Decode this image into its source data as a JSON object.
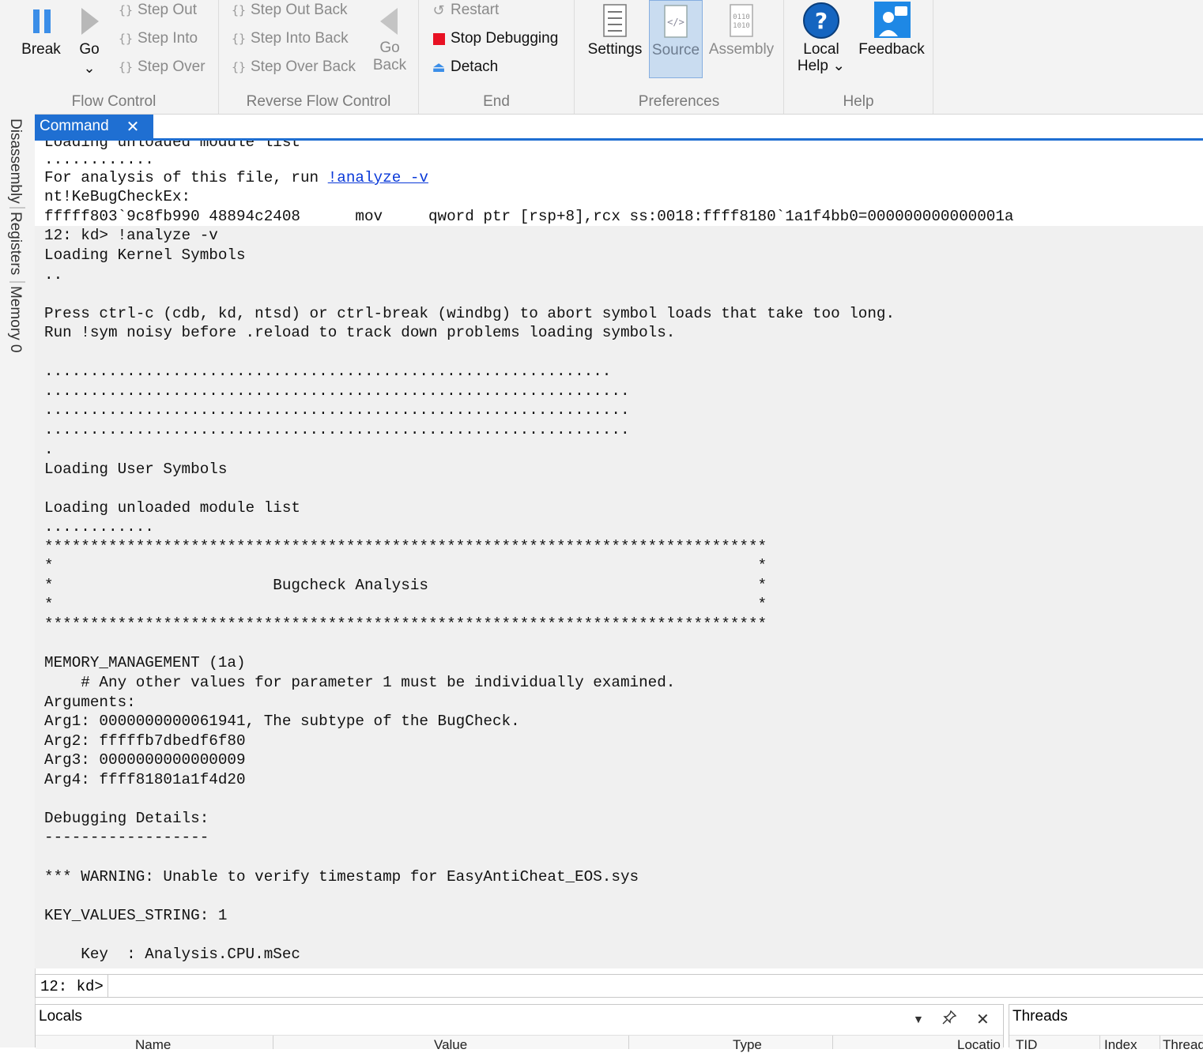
{
  "ribbon": {
    "flow_control": {
      "label": "Flow Control",
      "break": "Break",
      "go": "Go",
      "step_out": "Step Out",
      "step_into": "Step Into",
      "step_over": "Step Over"
    },
    "reverse_flow_control": {
      "label": "Reverse Flow Control",
      "step_out_back": "Step Out Back",
      "step_into_back": "Step Into Back",
      "step_over_back": "Step Over Back",
      "go_back_1": "Go",
      "go_back_2": "Back"
    },
    "end": {
      "label": "End",
      "restart": "Restart",
      "stop_debugging": "Stop Debugging",
      "detach": "Detach"
    },
    "preferences": {
      "label": "Preferences",
      "settings": "Settings",
      "source": "Source",
      "assembly": "Assembly"
    },
    "help": {
      "label": "Help",
      "local_help_1": "Local",
      "local_help_2": "Help",
      "feedback": "Feedback"
    }
  },
  "side_tabs": [
    "Disassembly",
    "Registers",
    "Memory 0"
  ],
  "command": {
    "tab_title": "Command",
    "output_lines": [
      "Loading unloaded module list",
      "............",
      "For analysis of this file, run ",
      "nt!KeBugCheckEx:",
      "fffff803`9c8fb990 48894c2408      mov     qword ptr [rsp+8],rcx ss:0018:ffff8180`1a1f4bb0=000000000000001a",
      "12: kd> !analyze -v",
      "Loading Kernel Symbols",
      "..",
      "",
      "Press ctrl-c (cdb, kd, ntsd) or ctrl-break (windbg) to abort symbol loads that take too long.",
      "Run !sym noisy before .reload to track down problems loading symbols.",
      "",
      "..............................................................",
      "................................................................",
      "................................................................",
      "................................................................",
      ".",
      "Loading User Symbols",
      "",
      "Loading unloaded module list",
      "............",
      "*******************************************************************************",
      "*                                                                             *",
      "*                        Bugcheck Analysis                                    *",
      "*                                                                             *",
      "*******************************************************************************",
      "",
      "MEMORY_MANAGEMENT (1a)",
      "    # Any other values for parameter 1 must be individually examined.",
      "Arguments:",
      "Arg1: 0000000000061941, The subtype of the BugCheck.",
      "Arg2: fffffb7dbedf6f80",
      "Arg3: 0000000000000009",
      "Arg4: ffff81801a1f4d20",
      "",
      "Debugging Details:",
      "------------------",
      "",
      "*** WARNING: Unable to verify timestamp for EasyAntiCheat_EOS.sys",
      "",
      "KEY_VALUES_STRING: 1",
      "",
      "    Key  : Analysis.CPU.mSec"
    ],
    "analyze_link": "!analyze -v",
    "prompt": "12: kd>"
  },
  "locals": {
    "title": "Locals",
    "columns": [
      "Name",
      "Value",
      "Type",
      "Locatio"
    ]
  },
  "threads": {
    "title": "Threads",
    "columns": [
      "TID",
      "Index",
      "Thread"
    ]
  },
  "colors": {
    "accent": "#1f6fd2",
    "link": "#0a39d8",
    "stop": "#e81123"
  }
}
